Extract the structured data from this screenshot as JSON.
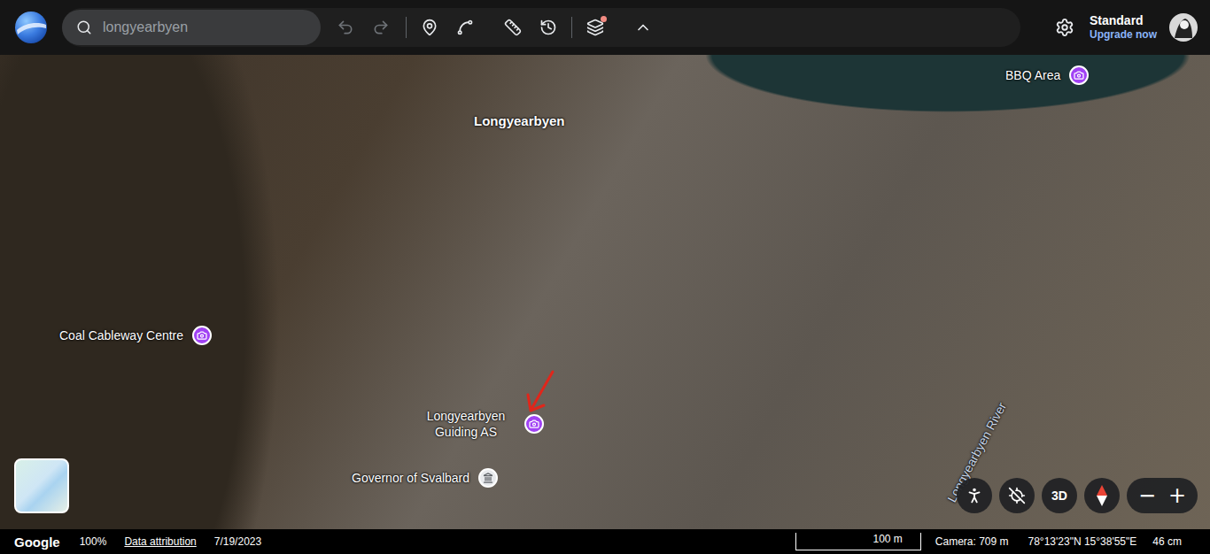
{
  "search": {
    "value": "longyearbyen"
  },
  "toolbar": {
    "layers_badge": true
  },
  "account": {
    "plan": "Standard",
    "upgrade": "Upgrade now"
  },
  "map": {
    "labels": [
      {
        "text": "Longyearbyen",
        "kind": "place"
      },
      {
        "text": "BBQ Area",
        "kind": "poi"
      },
      {
        "text": "Coal Cableway Centre",
        "kind": "poi"
      },
      {
        "text": "Longyearbyen Guiding AS",
        "kind": "poi-wrap"
      },
      {
        "text": "Governor of Svalbard",
        "kind": "gov"
      },
      {
        "text": "Longyearbyen River",
        "kind": "river"
      }
    ]
  },
  "controls": {
    "view_3d": "3D",
    "zoom_out": "−",
    "zoom_in": "+"
  },
  "status_bar": {
    "logo": "Google",
    "zoom": "100%",
    "attribution": "Data attribution",
    "date": "7/19/2023",
    "scale": "100 m",
    "camera": "Camera: 709 m",
    "coordinates": "78°13'23\"N 15°38'55\"E",
    "resolution": "46 cm"
  }
}
